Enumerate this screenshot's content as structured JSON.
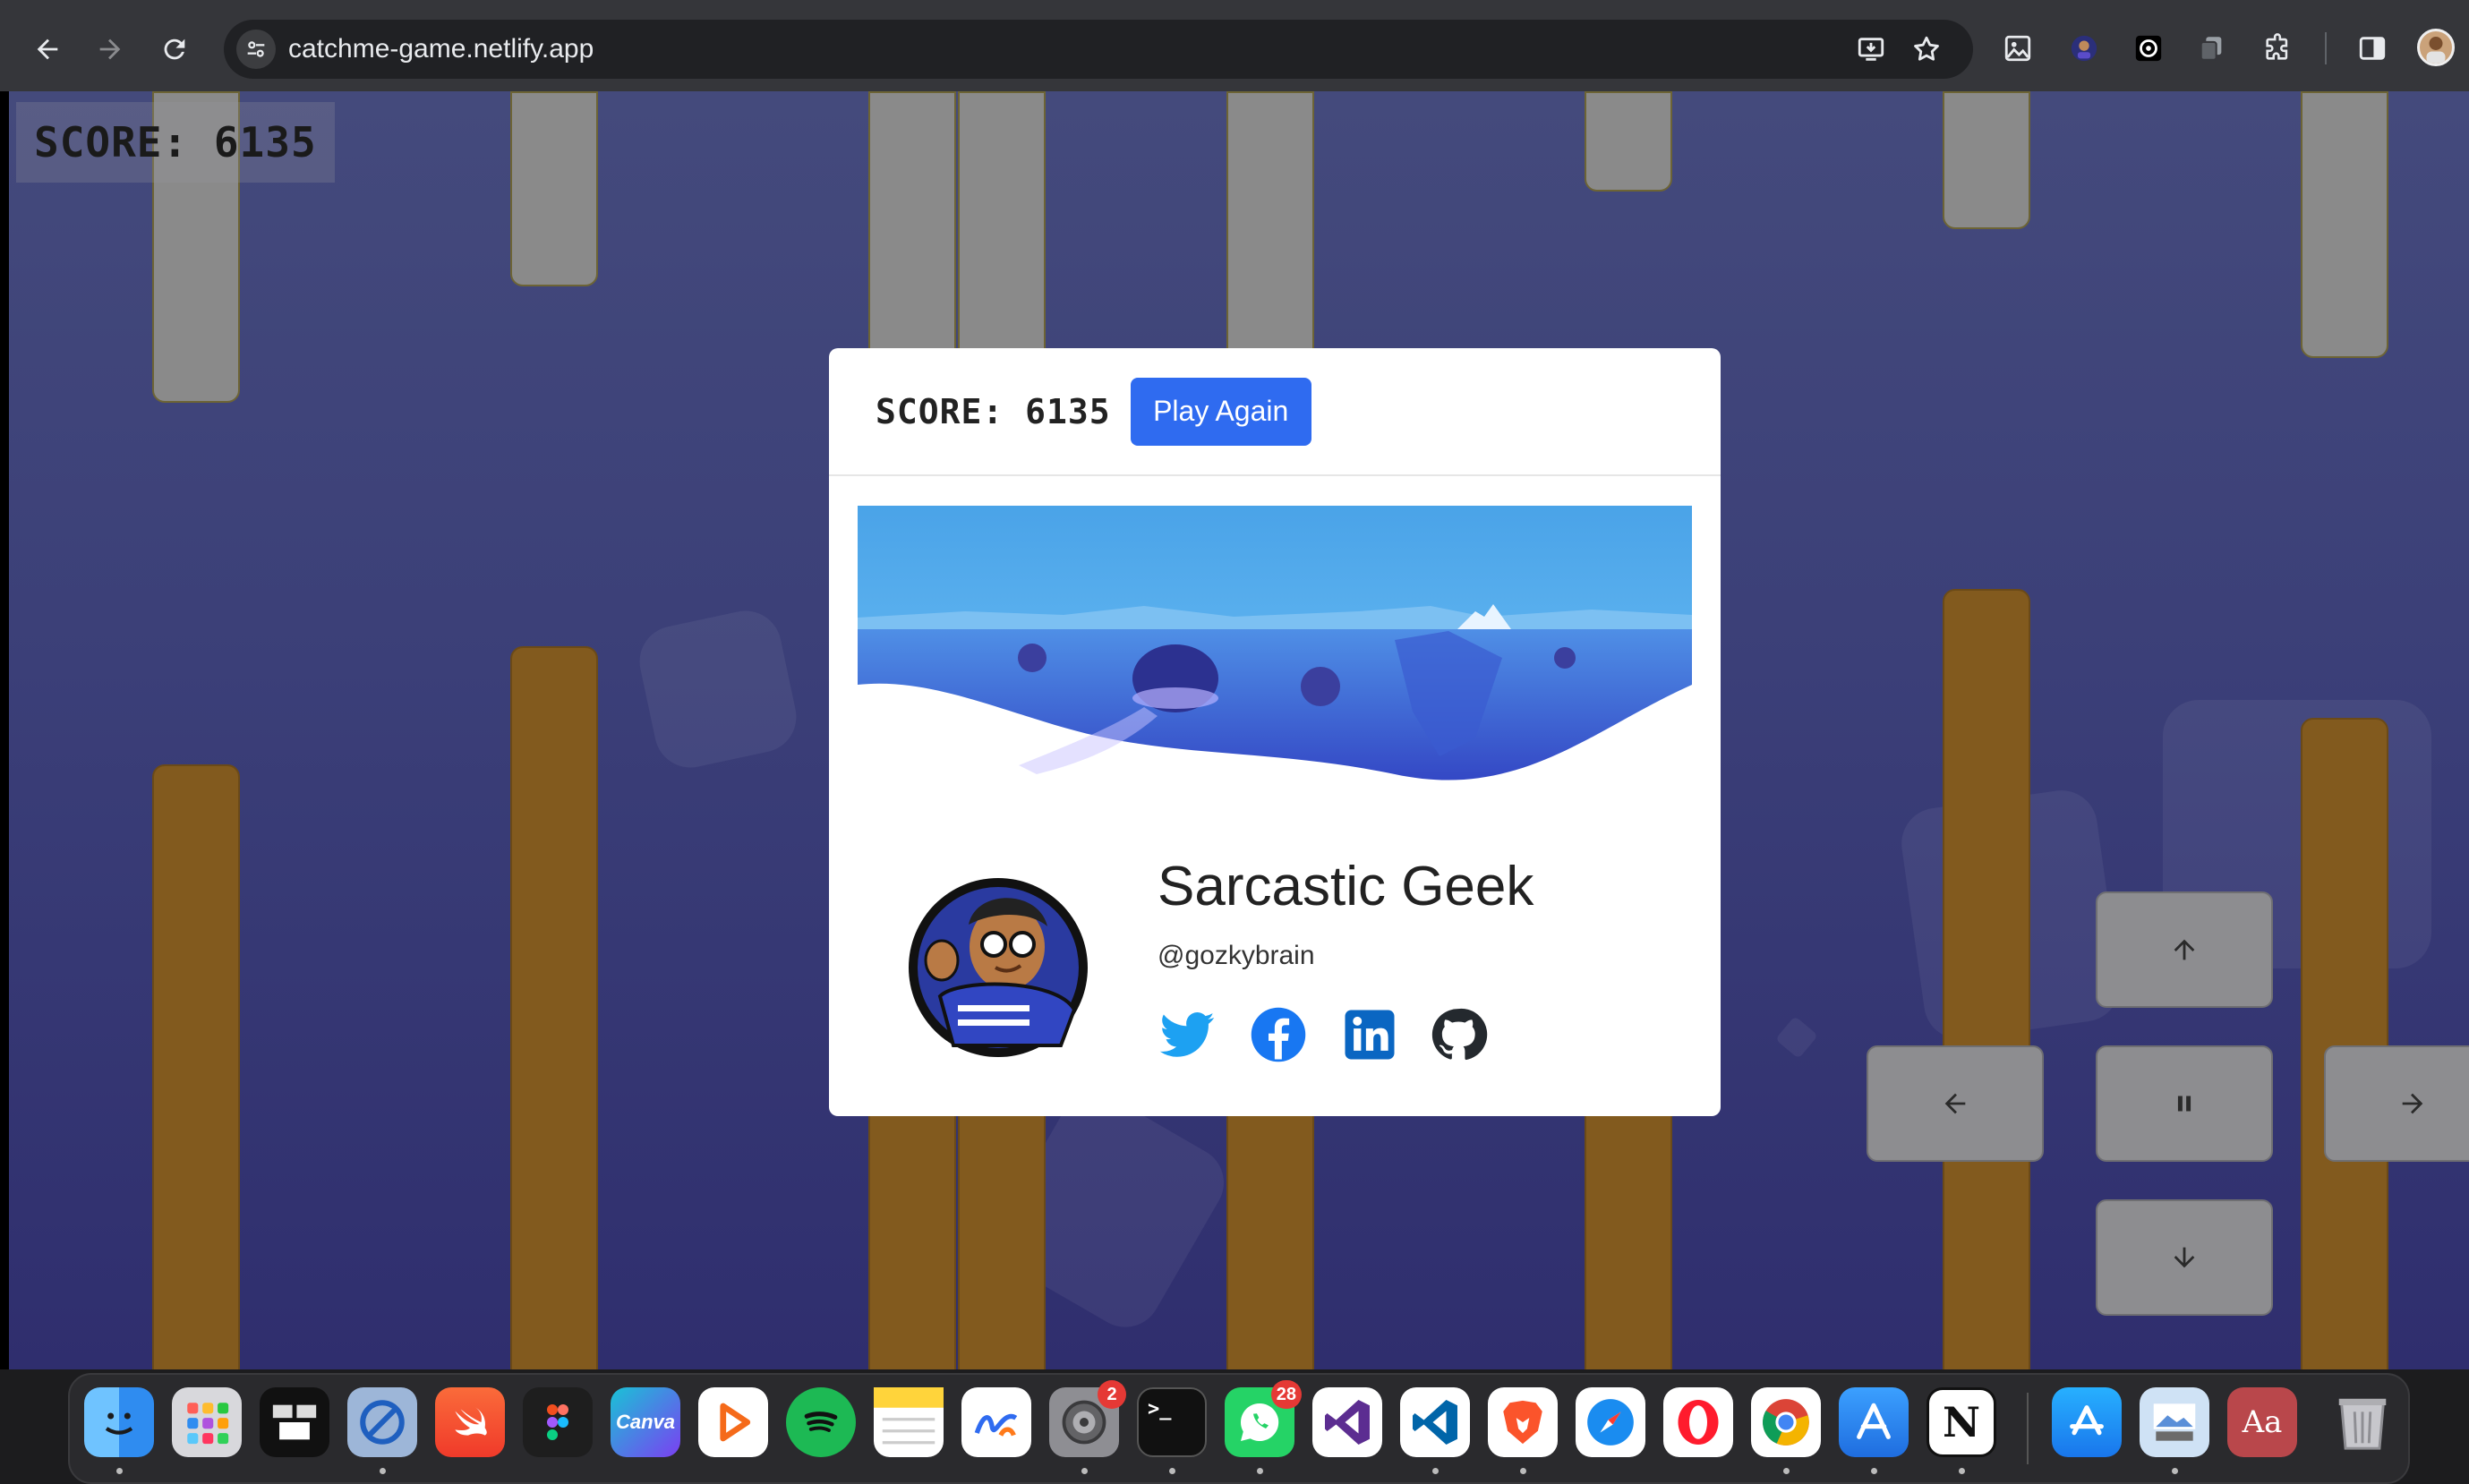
{
  "browser": {
    "url": "catchme-game.netlify.app",
    "nav": {
      "back": "arrow-left-icon",
      "forward": "arrow-right-icon",
      "reload": "reload-icon"
    },
    "extensions": [
      "image-icon",
      "avatar-ext-icon",
      "openai-icon",
      "copy-ext-icon",
      "puzzle-icon",
      "sidebar-icon"
    ]
  },
  "game": {
    "hud_score": "SCORE: 6135",
    "controls": {
      "up": "arrow-up-icon",
      "left": "arrow-left-icon",
      "pause": "pause-icon",
      "right": "arrow-right-icon",
      "down": "arrow-down-icon"
    },
    "colors": {
      "background": "#3b3f78",
      "pipe_top": "#8a8a8a",
      "pipe_bottom": "#825a1e",
      "control": "#8d8d90"
    }
  },
  "modal": {
    "score": "SCORE: 6135",
    "play_again": "Play Again",
    "profile": {
      "name": "Sarcastic Geek",
      "handle": "@gozkybrain",
      "socials": [
        "twitter-icon",
        "facebook-icon",
        "linkedin-icon",
        "github-icon"
      ]
    },
    "colors": {
      "button": "#2f6bf0",
      "twitter": "#1da1f2",
      "facebook": "#1877f2",
      "linkedin": "#0a66c2",
      "github": "#24292e"
    }
  },
  "dock": {
    "apps": [
      {
        "name": "Finder",
        "label": ""
      },
      {
        "name": "Launchpad",
        "label": ""
      },
      {
        "name": "Mission Control",
        "label": ""
      },
      {
        "name": "Screen Time",
        "label": ""
      },
      {
        "name": "Swift Playgrounds",
        "label": ""
      },
      {
        "name": "Figma",
        "label": ""
      },
      {
        "name": "Canva",
        "label": "Canva"
      },
      {
        "name": "Infuse",
        "label": ""
      },
      {
        "name": "Spotify",
        "label": ""
      },
      {
        "name": "Notes",
        "label": ""
      },
      {
        "name": "Freeform",
        "label": ""
      },
      {
        "name": "System Settings",
        "label": "",
        "badge": "2"
      },
      {
        "name": "Terminal",
        "label": ">_"
      },
      {
        "name": "WhatsApp",
        "label": "",
        "badge": "28"
      },
      {
        "name": "Visual Studio",
        "label": ""
      },
      {
        "name": "VS Code",
        "label": ""
      },
      {
        "name": "Brave",
        "label": ""
      },
      {
        "name": "Safari",
        "label": ""
      },
      {
        "name": "Opera",
        "label": ""
      },
      {
        "name": "Chrome",
        "label": ""
      },
      {
        "name": "Xcode",
        "label": ""
      },
      {
        "name": "Notion",
        "label": "N"
      },
      {
        "name": "App Store",
        "label": ""
      },
      {
        "name": "Preview",
        "label": ""
      },
      {
        "name": "Dictionary",
        "label": "Aa"
      },
      {
        "name": "Trash",
        "label": ""
      }
    ]
  }
}
